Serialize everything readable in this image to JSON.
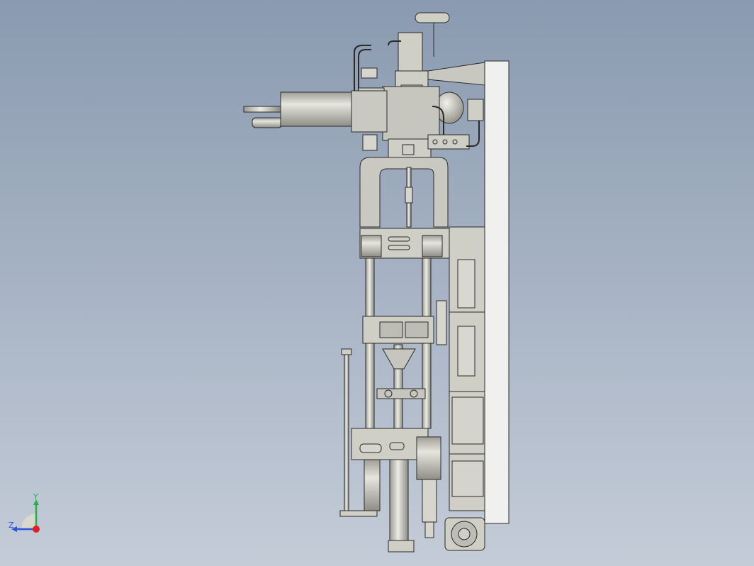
{
  "viewport": {
    "background_top": "#8a9ab0",
    "background_bottom": "#c4ccd8",
    "model_fill": "#cfcfc6",
    "model_stroke": "#2a2a2a",
    "panel_fill": "#f0f0ee"
  },
  "triad": {
    "y_label": "Y",
    "z_label": "Z",
    "y_color": "#22b24a",
    "z_color": "#2a55d6",
    "x_color": "#e02020"
  }
}
